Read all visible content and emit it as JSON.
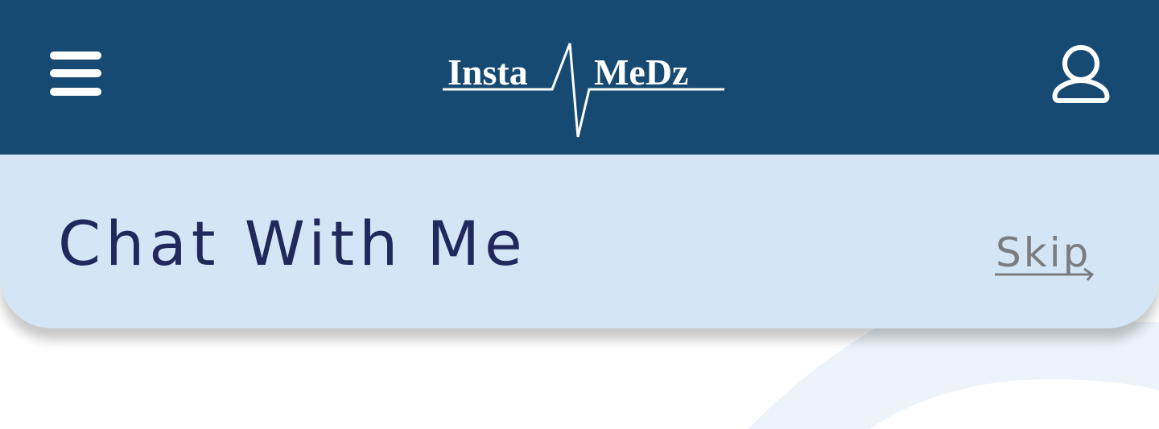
{
  "header": {
    "brand_left": "Insta",
    "brand_right": "MeDz",
    "background_color": "#164a72",
    "menu_icon": "hamburger-menu-icon",
    "profile_icon": "user-profile-icon"
  },
  "banner": {
    "title": "Chat With Me",
    "skip_label": "Skip",
    "skip_icon": "arrow-right-icon",
    "background_color": "#d4e6f6",
    "title_color": "#20285c"
  },
  "colors": {
    "accent": "#164a72",
    "swoosh": "#edf3f9"
  }
}
